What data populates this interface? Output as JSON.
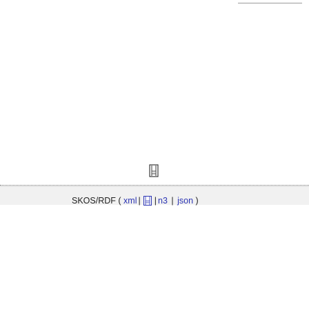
{
  "format_label": "SKOS/RDF",
  "open_paren": "(",
  "close_paren": ")",
  "separator": "|",
  "links": {
    "xml": "xml",
    "n3": "n3",
    "json": "json"
  },
  "icons": {
    "center": "document-icon",
    "inline": "file-icon"
  },
  "colors": {
    "link": "#2c35b4",
    "footer_bg": "#f1f1f1"
  }
}
